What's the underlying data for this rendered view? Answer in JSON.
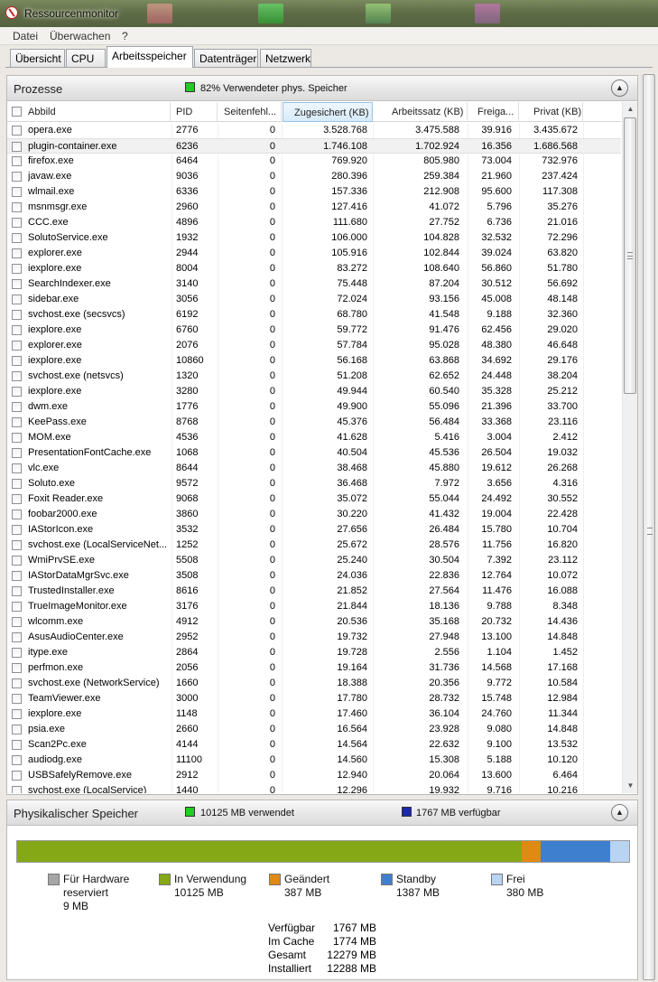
{
  "window": {
    "title": "Ressourcenmonitor"
  },
  "menu": [
    "Datei",
    "Überwachen",
    "?"
  ],
  "tabs": [
    "Übersicht",
    "CPU",
    "Arbeitsspeicher",
    "Datenträger",
    "Netzwerk"
  ],
  "active_tab": "Arbeitsspeicher",
  "processes": {
    "title": "Prozesse",
    "indicator_text": "82% Verwendeter phys. Speicher",
    "indicator_color": "#22cc22",
    "columns": [
      "Abbild",
      "PID",
      "Seitenfehl...",
      "Zugesichert (KB)",
      "Arbeitssatz (KB)",
      "Freiga...",
      "Privat (KB)"
    ],
    "rows": [
      [
        "opera.exe",
        "2776",
        "0",
        "3.528.768",
        "3.475.588",
        "39.916",
        "3.435.672"
      ],
      [
        "plugin-container.exe",
        "6236",
        "0",
        "1.746.108",
        "1.702.924",
        "16.356",
        "1.686.568"
      ],
      [
        "firefox.exe",
        "6464",
        "0",
        "769.920",
        "805.980",
        "73.004",
        "732.976"
      ],
      [
        "javaw.exe",
        "9036",
        "0",
        "280.396",
        "259.384",
        "21.960",
        "237.424"
      ],
      [
        "wlmail.exe",
        "6336",
        "0",
        "157.336",
        "212.908",
        "95.600",
        "117.308"
      ],
      [
        "msnmsgr.exe",
        "2960",
        "0",
        "127.416",
        "41.072",
        "5.796",
        "35.276"
      ],
      [
        "CCC.exe",
        "4896",
        "0",
        "111.680",
        "27.752",
        "6.736",
        "21.016"
      ],
      [
        "SolutoService.exe",
        "1932",
        "0",
        "106.000",
        "104.828",
        "32.532",
        "72.296"
      ],
      [
        "explorer.exe",
        "2944",
        "0",
        "105.916",
        "102.844",
        "39.024",
        "63.820"
      ],
      [
        "iexplore.exe",
        "8004",
        "0",
        "83.272",
        "108.640",
        "56.860",
        "51.780"
      ],
      [
        "SearchIndexer.exe",
        "3140",
        "0",
        "75.448",
        "87.204",
        "30.512",
        "56.692"
      ],
      [
        "sidebar.exe",
        "3056",
        "0",
        "72.024",
        "93.156",
        "45.008",
        "48.148"
      ],
      [
        "svchost.exe (secsvcs)",
        "6192",
        "0",
        "68.780",
        "41.548",
        "9.188",
        "32.360"
      ],
      [
        "iexplore.exe",
        "6760",
        "0",
        "59.772",
        "91.476",
        "62.456",
        "29.020"
      ],
      [
        "explorer.exe",
        "2076",
        "0",
        "57.784",
        "95.028",
        "48.380",
        "46.648"
      ],
      [
        "iexplore.exe",
        "10860",
        "0",
        "56.168",
        "63.868",
        "34.692",
        "29.176"
      ],
      [
        "svchost.exe (netsvcs)",
        "1320",
        "0",
        "51.208",
        "62.652",
        "24.448",
        "38.204"
      ],
      [
        "iexplore.exe",
        "3280",
        "0",
        "49.944",
        "60.540",
        "35.328",
        "25.212"
      ],
      [
        "dwm.exe",
        "1776",
        "0",
        "49.900",
        "55.096",
        "21.396",
        "33.700"
      ],
      [
        "KeePass.exe",
        "8768",
        "0",
        "45.376",
        "56.484",
        "33.368",
        "23.116"
      ],
      [
        "MOM.exe",
        "4536",
        "0",
        "41.628",
        "5.416",
        "3.004",
        "2.412"
      ],
      [
        "PresentationFontCache.exe",
        "1068",
        "0",
        "40.504",
        "45.536",
        "26.504",
        "19.032"
      ],
      [
        "vlc.exe",
        "8644",
        "0",
        "38.468",
        "45.880",
        "19.612",
        "26.268"
      ],
      [
        "Soluto.exe",
        "9572",
        "0",
        "36.468",
        "7.972",
        "3.656",
        "4.316"
      ],
      [
        "Foxit Reader.exe",
        "9068",
        "0",
        "35.072",
        "55.044",
        "24.492",
        "30.552"
      ],
      [
        "foobar2000.exe",
        "3860",
        "0",
        "30.220",
        "41.432",
        "19.004",
        "22.428"
      ],
      [
        "IAStorIcon.exe",
        "3532",
        "0",
        "27.656",
        "26.484",
        "15.780",
        "10.704"
      ],
      [
        "svchost.exe (LocalServiceNet...",
        "1252",
        "0",
        "25.672",
        "28.576",
        "11.756",
        "16.820"
      ],
      [
        "WmiPrvSE.exe",
        "5508",
        "0",
        "25.240",
        "30.504",
        "7.392",
        "23.112"
      ],
      [
        "IAStorDataMgrSvc.exe",
        "3508",
        "0",
        "24.036",
        "22.836",
        "12.764",
        "10.072"
      ],
      [
        "TrustedInstaller.exe",
        "8616",
        "0",
        "21.852",
        "27.564",
        "11.476",
        "16.088"
      ],
      [
        "TrueImageMonitor.exe",
        "3176",
        "0",
        "21.844",
        "18.136",
        "9.788",
        "8.348"
      ],
      [
        "wlcomm.exe",
        "4912",
        "0",
        "20.536",
        "35.168",
        "20.732",
        "14.436"
      ],
      [
        "AsusAudioCenter.exe",
        "2952",
        "0",
        "19.732",
        "27.948",
        "13.100",
        "14.848"
      ],
      [
        "itype.exe",
        "2864",
        "0",
        "19.728",
        "2.556",
        "1.104",
        "1.452"
      ],
      [
        "perfmon.exe",
        "2056",
        "0",
        "19.164",
        "31.736",
        "14.568",
        "17.168"
      ],
      [
        "svchost.exe (NetworkService)",
        "1660",
        "0",
        "18.388",
        "20.356",
        "9.772",
        "10.584"
      ],
      [
        "TeamViewer.exe",
        "3000",
        "0",
        "17.780",
        "28.732",
        "15.748",
        "12.984"
      ],
      [
        "iexplore.exe",
        "1148",
        "0",
        "17.460",
        "36.104",
        "24.760",
        "11.344"
      ],
      [
        "psia.exe",
        "2660",
        "0",
        "16.564",
        "23.928",
        "9.080",
        "14.848"
      ],
      [
        "Scan2Pc.exe",
        "4144",
        "0",
        "14.564",
        "22.632",
        "9.100",
        "13.532"
      ],
      [
        "audiodg.exe",
        "11100",
        "0",
        "14.560",
        "15.308",
        "5.188",
        "10.120"
      ],
      [
        "USBSafelyRemove.exe",
        "2912",
        "0",
        "12.940",
        "20.064",
        "13.600",
        "6.464"
      ],
      [
        "svchost.exe (LocalService)",
        "1440",
        "0",
        "12.296",
        "19.932",
        "9.716",
        "10.216"
      ]
    ]
  },
  "physical": {
    "title": "Physikalischer Speicher",
    "used_text": "10125 MB verwendet",
    "used_color": "#22cc22",
    "avail_text": "1767 MB verfügbar",
    "avail_color": "#1a2aa8",
    "bar_mb": {
      "reserved": 9,
      "in_use": 10125,
      "modified": 387,
      "standby": 1387,
      "free": 380
    },
    "colors": {
      "reserved": "#a6a6a6",
      "in_use": "#85a817",
      "modified": "#e08a13",
      "standby": "#3f7fd0",
      "free": "#b9d3f2"
    },
    "legend": [
      {
        "key": "reserved",
        "line1": "Für Hardware",
        "line2": "reserviert",
        "line3": "9 MB"
      },
      {
        "key": "in_use",
        "line1": "In Verwendung",
        "line2": "10125 MB",
        "line3": ""
      },
      {
        "key": "modified",
        "line1": "Geändert",
        "line2": "387 MB",
        "line3": ""
      },
      {
        "key": "standby",
        "line1": "Standby",
        "line2": "1387 MB",
        "line3": ""
      },
      {
        "key": "free",
        "line1": "Frei",
        "line2": "380 MB",
        "line3": ""
      }
    ],
    "stats": [
      {
        "label": "Verfügbar",
        "value": "1767 MB"
      },
      {
        "label": "Im Cache",
        "value": "1774 MB"
      },
      {
        "label": "Gesamt",
        "value": "12279 MB"
      },
      {
        "label": "Installiert",
        "value": "12288 MB"
      }
    ]
  }
}
